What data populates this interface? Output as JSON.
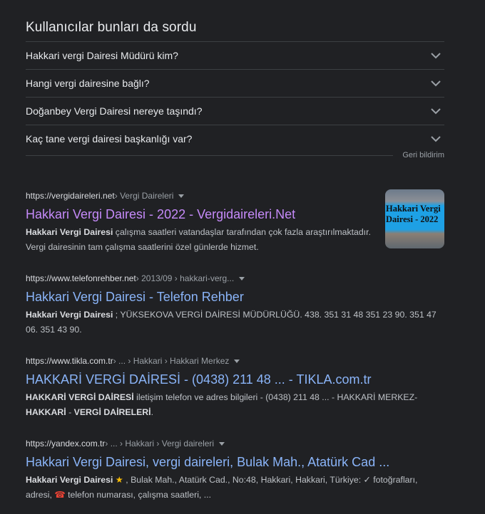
{
  "paa": {
    "title": "Kullanıcılar bunları da sordu",
    "questions": [
      "Hakkari vergi Dairesi Müdürü kim?",
      "Hangi vergi dairesine bağlı?",
      "Doğanbey Vergi Dairesi nereye taşındı?",
      "Kaç tane vergi dairesi başkanlığı var?"
    ],
    "feedback": "Geri bildirim"
  },
  "results": [
    {
      "domain": "https://vergidaireleri.net",
      "crumb": " › Vergi Daireleri",
      "title": "Hakkari Vergi Dairesi - 2022 - Vergidaireleri.Net",
      "snippet_bold": "Hakkari Vergi Dairesi",
      "snippet": " çalışma saatleri vatandaşlar tarafından çok fazla araştırılmaktadır. Vergi dairesinin tam çalışma saatlerini özel günlerde hizmet.",
      "thumb_line1": "Hakkari Vergi",
      "thumb_line2": "Dairesi - 2022"
    },
    {
      "domain": "https://www.telefonrehber.net",
      "crumb": " › 2013/09 › hakkari-verg...",
      "title": "Hakkari Vergi Dairesi - Telefon Rehber",
      "snippet_bold": "Hakkari Vergi Dairesi",
      "snippet": " ; YÜKSEKOVA VERGİ DAİRESİ MÜDÜRLÜĞÜ. 438. 351 31 48 351 23 90. 351 47 06. 351 43 90."
    },
    {
      "domain": "https://www.tikla.com.tr",
      "crumb": " › ... › Hakkari › Hakkari Merkez",
      "title": "HAKKARİ VERGİ DAİRESİ - (0438) 211 48 ... - TIKLA.com.tr",
      "snippet_bold": "HAKKARİ VERGİ DAİRESİ",
      "snippet": " iletişim telefon ve adres bilgileri - (0438) 211 48 ... - HAKKARİ MERKEZ-",
      "snippet_bold2": "HAKKARİ",
      "snippet_mid": " - ",
      "snippet_bold3": "VERGİ DAİRELERİ",
      "snippet_end": "."
    },
    {
      "domain": "https://yandex.com.tr",
      "crumb": " › ... › Hakkari › Vergi daireleri",
      "title": "Hakkari Vergi Dairesi, vergi daireleri, Bulak Mah., Atatürk Cad ...",
      "snippet_bold": "Hakkari Vergi Dairesi",
      "star": "★",
      "snippet": " , Bulak Mah., Atatürk Cad., No:48, Hakkari, Hakkari, Türkiye: ✓ fotoğrafları, adresi, ",
      "phone": "☎",
      "snippet_end": " telefon numarası, çalışma saatleri, ..."
    }
  ]
}
